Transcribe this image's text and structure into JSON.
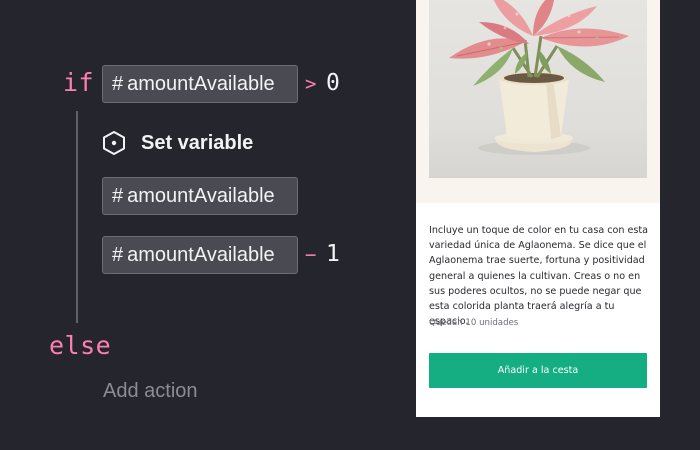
{
  "logic": {
    "if_keyword": "if",
    "else_keyword": "else",
    "condition": {
      "hash": "#",
      "variable": "amountAvailable",
      "operator": ">",
      "value": "0"
    },
    "action": {
      "icon": "hexagon-dot-icon",
      "label": "Set variable",
      "target": {
        "hash": "#",
        "variable": "amountAvailable"
      },
      "expression": {
        "hash": "#",
        "variable": "amountAvailable",
        "operator": "−",
        "value": "1"
      }
    },
    "add_action_label": "Add action"
  },
  "product": {
    "image_icon": "potted-plant-photo",
    "description": "Incluye un toque de color en tu casa con esta variedad única de Aglaonema. Se dice que el Aglaonema trae suerte, fortuna y positividad general a quienes la cultivan. Creas o no en sus poderes ocultos, no se puede negar que esta colorida planta traerá alegría a tu espacio.",
    "stock": "Quedan 10 unidades",
    "button_label": "Añadir a la cesta"
  },
  "colors": {
    "background": "#25252d",
    "keyword": "#ff7eb3",
    "chip_background": "#4a4b52",
    "button": "#15ad82"
  }
}
